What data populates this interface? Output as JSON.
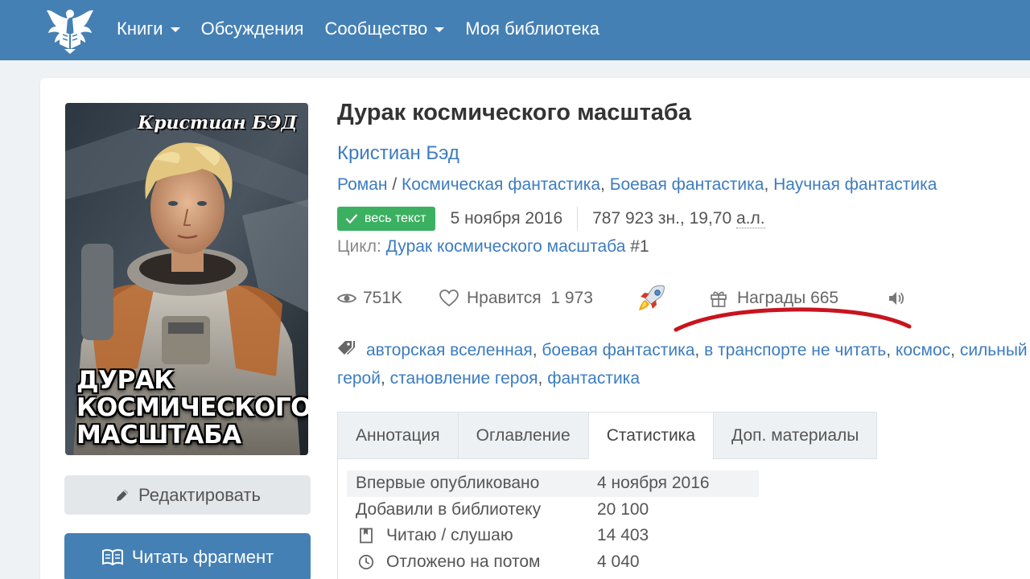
{
  "nav": {
    "items": [
      {
        "label": "Книги",
        "dropdown": true
      },
      {
        "label": "Обсуждения",
        "dropdown": false
      },
      {
        "label": "Сообщество",
        "dropdown": true
      },
      {
        "label": "Моя библиотека",
        "dropdown": false
      }
    ]
  },
  "cover": {
    "author_text": "Кристиан БЭД",
    "title_lines": [
      "ДУРАК",
      "КОСМИЧЕСКОГО",
      "МАСШТАБА"
    ]
  },
  "buttons": {
    "edit": "Редактировать",
    "read": "Читать фрагмент"
  },
  "book": {
    "title": "Дурак космического масштаба",
    "author": "Кристиан Бэд",
    "form": "Роман",
    "genre_sep": " / ",
    "genres": [
      "Космическая фантастика",
      "Боевая фантастика",
      "Научная фантастика"
    ],
    "badge": "весь текст",
    "date": "5 ноября 2016",
    "size_chars": "787 923 зн., 19,70 ",
    "size_unit": "а.л.",
    "cycle_label": "Цикл: ",
    "cycle_name": "Дурак космического масштаба",
    "cycle_num": " #1"
  },
  "stats": {
    "views": "751K",
    "likes_label": "Нравится",
    "likes_count": "1 973",
    "awards_label": "Награды",
    "awards_count": "665"
  },
  "tags": [
    "авторская вселенная",
    "боевая фантастика",
    "в транспорте не читать",
    "космос",
    "сильный",
    "герой",
    "становление героя",
    "фантастика"
  ],
  "tabs": [
    {
      "label": "Аннотация",
      "active": false
    },
    {
      "label": "Оглавление",
      "active": false
    },
    {
      "label": "Статистика",
      "active": true
    },
    {
      "label": "Доп. материалы",
      "active": false
    }
  ],
  "stats_table": [
    {
      "label": "Впервые опубликовано",
      "value": "4 ноября 2016",
      "icon": ""
    },
    {
      "label": "Добавили в библиотеку",
      "value": "20 100",
      "icon": ""
    },
    {
      "label": "Читаю / слушаю",
      "value": "14 403",
      "icon": "bookmark-icon"
    },
    {
      "label": "Отложено на потом",
      "value": "4 040",
      "icon": "clock-icon"
    }
  ],
  "colors": {
    "navbar": "#4580b4",
    "link": "#3c7cc0",
    "badge_green": "#3cb061",
    "annotation_red": "#c8141e"
  }
}
